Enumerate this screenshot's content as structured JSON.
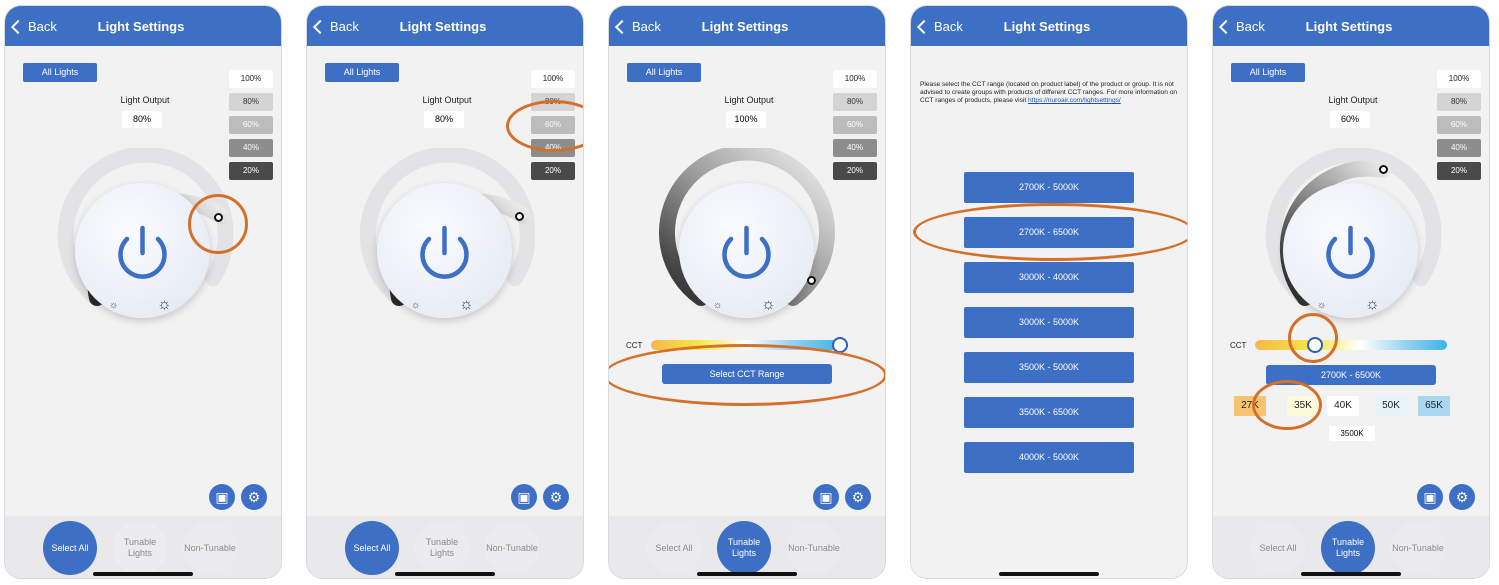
{
  "common": {
    "back_label": "Back",
    "title": "Light Settings",
    "all_lights": "All Lights",
    "light_output_label": "Light Output",
    "levels": [
      "100%",
      "80%",
      "60%",
      "40%",
      "20%"
    ],
    "cct_label": "CCT",
    "tabs": [
      "Select All",
      "Tunable Lights",
      "Non-Tunable"
    ],
    "accent_color": "#3d6fc4",
    "highlight_color": "#d4702a",
    "icons": {
      "back": "chevron-left-icon",
      "power": "power-icon",
      "sun_small": "sun-small-icon",
      "sun_large": "sun-large-icon",
      "save": "save-icon",
      "settings": "gear-icon"
    }
  },
  "screen1": {
    "light_output": "80%",
    "selected_tab": "Select All"
  },
  "screen2": {
    "light_output": "80%",
    "selected_tab": "Select All"
  },
  "screen3": {
    "light_output": "100%",
    "select_cct_button": "Select CCT Range",
    "selected_tab": "Tunable Lights"
  },
  "screen4": {
    "instructions": "Please select the CCT range (located on product label) of the product or group. It is not advised to create groups with products of different CCT ranges. For more information on CCT ranges of products, please visit",
    "link": "https://nuroair.com/lightsettings/",
    "ranges": [
      "2700K - 5000K",
      "2700K - 6500K",
      "3000K - 4000K",
      "3000K - 5000K",
      "3500K - 5000K",
      "3500K - 6500K",
      "4000K - 5000K"
    ]
  },
  "screen5": {
    "light_output": "60%",
    "cct_range_button": "2700K - 6500K",
    "cct_presets": [
      "27K",
      "35K",
      "40K",
      "50K",
      "65K"
    ],
    "selected_cct": "3500K",
    "selected_tab": "Tunable Lights"
  }
}
